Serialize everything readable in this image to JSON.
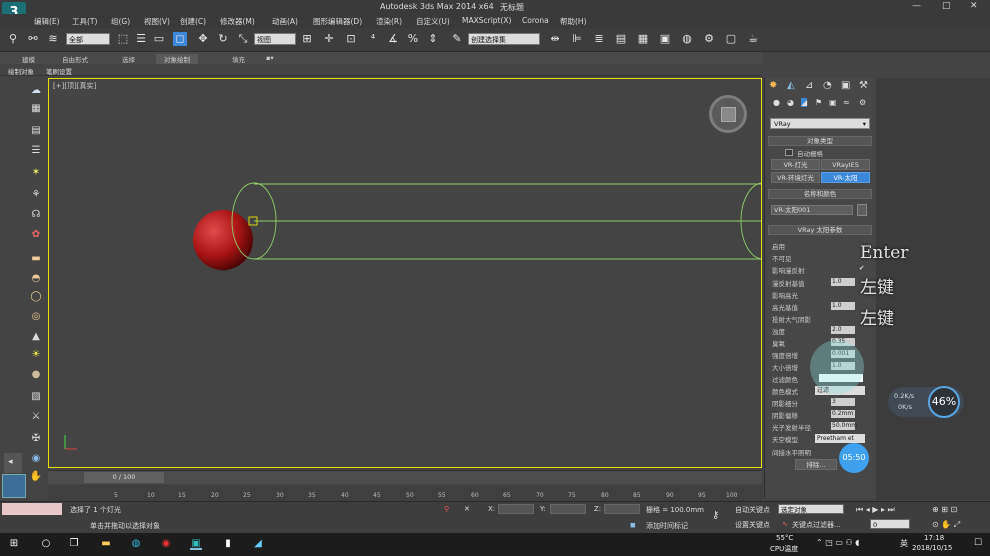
{
  "titlebar": {
    "title": "Autodesk 3ds Max  2014 x64",
    "doc": "无标题",
    "minimize": "—",
    "maximize": "□",
    "close": "✕"
  },
  "menu": [
    "编辑(E)",
    "工具(T)",
    "组(G)",
    "视图(V)",
    "创建(C)",
    "修改器(M)",
    "动画(A)",
    "图形编辑器(D)",
    "渲染(R)",
    "自定义(U)",
    "MAXScript(X)",
    "Corona",
    "帮助(H)"
  ],
  "toolbar": {
    "filter": "全部",
    "view": "视图",
    "selection_set": "创建选择集"
  },
  "ribbon": {
    "tabs": [
      "建模",
      "自由形式",
      "选择",
      "对象绘制",
      "填充"
    ],
    "sub": [
      "绘制对象",
      "笔刷设置"
    ]
  },
  "viewport": {
    "label": "[+][顶][真实]"
  },
  "timeline": {
    "frame": "0 / 100",
    "ticks": [
      "5",
      "10",
      "15",
      "20",
      "25",
      "30",
      "35",
      "40",
      "45",
      "50",
      "55",
      "60",
      "65",
      "70",
      "75",
      "80",
      "85",
      "90",
      "95",
      "100"
    ]
  },
  "status": {
    "line1": "选择了 1 个灯光",
    "line2": "单击并拖动以选择对象",
    "x": "X:",
    "y": "Y:",
    "z": "Z:",
    "grid": "栅格 = 100.0mm",
    "add_time_tag": "添加时间标记",
    "auto_key": "自动关键点",
    "set_key": "设置关键点",
    "selected": "选定对象",
    "key_filter": "关键点过滤器...",
    "frame_field": "0"
  },
  "cmdpanel": {
    "dropdown": "VRay",
    "object_type": {
      "header": "对象类型",
      "autogrid": "自动栅格",
      "buttons": [
        "VR-灯光",
        "VRayIES",
        "VR-环境灯光",
        "VR-太阳"
      ]
    },
    "name_color": {
      "header": "名称和颜色",
      "name": "VR-太阳001"
    },
    "sun_params": {
      "header": "VRay 太阳参数",
      "rows": [
        {
          "label": "启用",
          "value": ""
        },
        {
          "label": "不可见",
          "value": ""
        },
        {
          "label": "影响漫反射",
          "value": "✔"
        },
        {
          "label": "漫反射基值",
          "value": "1.0"
        },
        {
          "label": "影响高光",
          "value": ""
        },
        {
          "label": "高光基值",
          "value": "1.0"
        },
        {
          "label": "投射大气阴影",
          "value": ""
        },
        {
          "label": "浊度",
          "value": "2.0"
        },
        {
          "label": "臭氧",
          "value": "0.35"
        },
        {
          "label": "强度倍增",
          "value": "0.001"
        },
        {
          "label": "大小倍增",
          "value": "1.0"
        },
        {
          "label": "过滤颜色",
          "value": ""
        },
        {
          "label": "颜色模式",
          "value": "过滤"
        },
        {
          "label": "阴影细分",
          "value": "3"
        },
        {
          "label": "阴影偏移",
          "value": "0.2mm"
        },
        {
          "label": "光子发射半径",
          "value": "50.0mm"
        },
        {
          "label": "天空模型",
          "value": "Preetham et"
        },
        {
          "label": "间接水平照明",
          "value": ""
        },
        {
          "label": "排除...",
          "value": ""
        }
      ]
    }
  },
  "overlay_keys": [
    "Enter",
    "左键",
    "左键"
  ],
  "perf": {
    "up": "0.2K/s",
    "down": "0K/s",
    "percent": "46%"
  },
  "timer": "05:50",
  "taskbar": {
    "temp": "55°C",
    "temp_label": "CPU温度",
    "ime": "英",
    "time": "17:18",
    "date": "2018/10/15"
  },
  "colors": {
    "accent": "#3b87d8",
    "viewport_border": "#e8e000",
    "sphere": "#b01818",
    "light_gizmo": "#8fd06a"
  }
}
